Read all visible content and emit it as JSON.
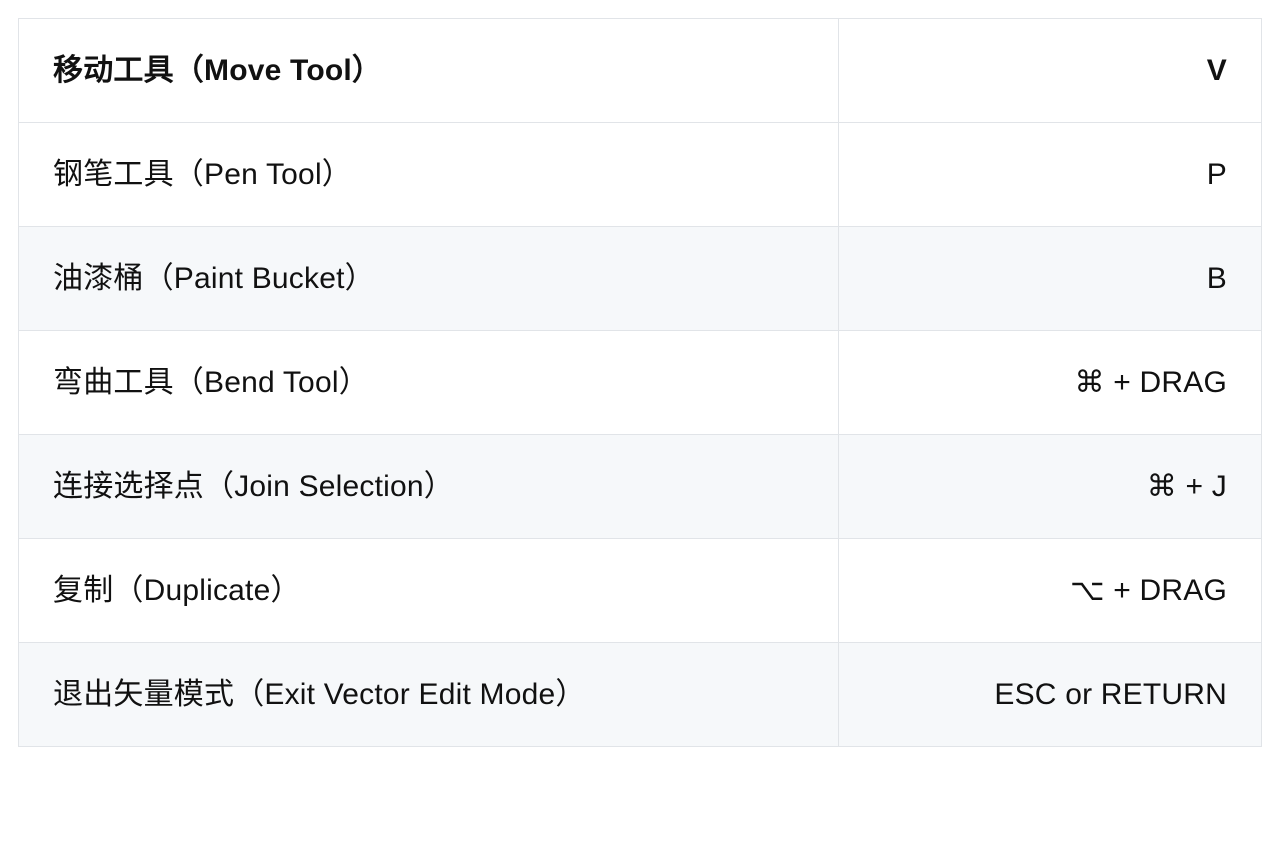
{
  "table": {
    "header": {
      "label": "移动工具（Move Tool）",
      "key": "V"
    },
    "rows": [
      {
        "label": "钢笔工具（Pen Tool）",
        "key": "P"
      },
      {
        "label": "油漆桶（Paint Bucket）",
        "key": "B"
      },
      {
        "label": "弯曲工具（Bend Tool）",
        "key": "⌘ + DRAG"
      },
      {
        "label": "连接选择点（Join Selection）",
        "key": "⌘ + J"
      },
      {
        "label": "复制（Duplicate）",
        "key": "⌥ + DRAG"
      },
      {
        "label": "退出矢量模式（Exit Vector Edit Mode）",
        "key": "ESC or RETURN"
      }
    ]
  }
}
